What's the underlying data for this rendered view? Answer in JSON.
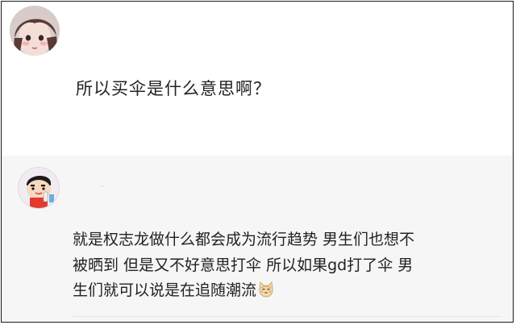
{
  "post": {
    "avatar_icon": "girl-avatar-icon",
    "text": "所以买伞是什么意思啊？"
  },
  "reply": {
    "avatar_icon": "crayon-shinchan-avatar-icon",
    "line1": "就是权志龙做什么都会成为流行趋势 男生们也想不",
    "line2": "被晒到 但是又不好意思打伞 所以如果gd打了伞 男",
    "line3": "生们就可以说是在追随潮流",
    "emoji_icon": "cat-emoji-icon"
  },
  "colors": {
    "post_bg": "#ffffff",
    "reply_bg": "#f6f6f6",
    "text": "#222222"
  }
}
